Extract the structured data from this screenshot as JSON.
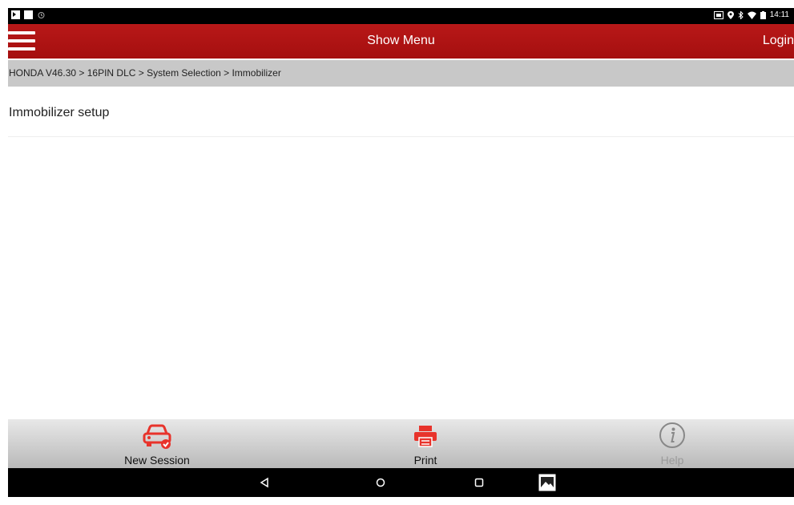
{
  "status_bar": {
    "time": "14:11",
    "left_icons": [
      "notification-icon",
      "square-icon",
      "alarm-icon"
    ],
    "right_icons": [
      "sim-icon",
      "location-icon",
      "bluetooth-icon",
      "wifi-icon",
      "battery-icon"
    ]
  },
  "app_bar": {
    "title": "Show Menu",
    "login_label": "Login",
    "brand_color": "#b01313"
  },
  "breadcrumb": "HONDA V46.30 > 16PIN DLC > System Selection > Immobilizer",
  "list": {
    "items": [
      {
        "label": "Immobilizer setup"
      }
    ]
  },
  "toolbar": {
    "new_session_label": "New Session",
    "print_label": "Print",
    "help_label": "Help",
    "accent_color": "#e8332b"
  },
  "nav_bar": {
    "buttons": [
      "back-icon",
      "home-icon",
      "recents-icon",
      "screenshot-icon"
    ]
  }
}
